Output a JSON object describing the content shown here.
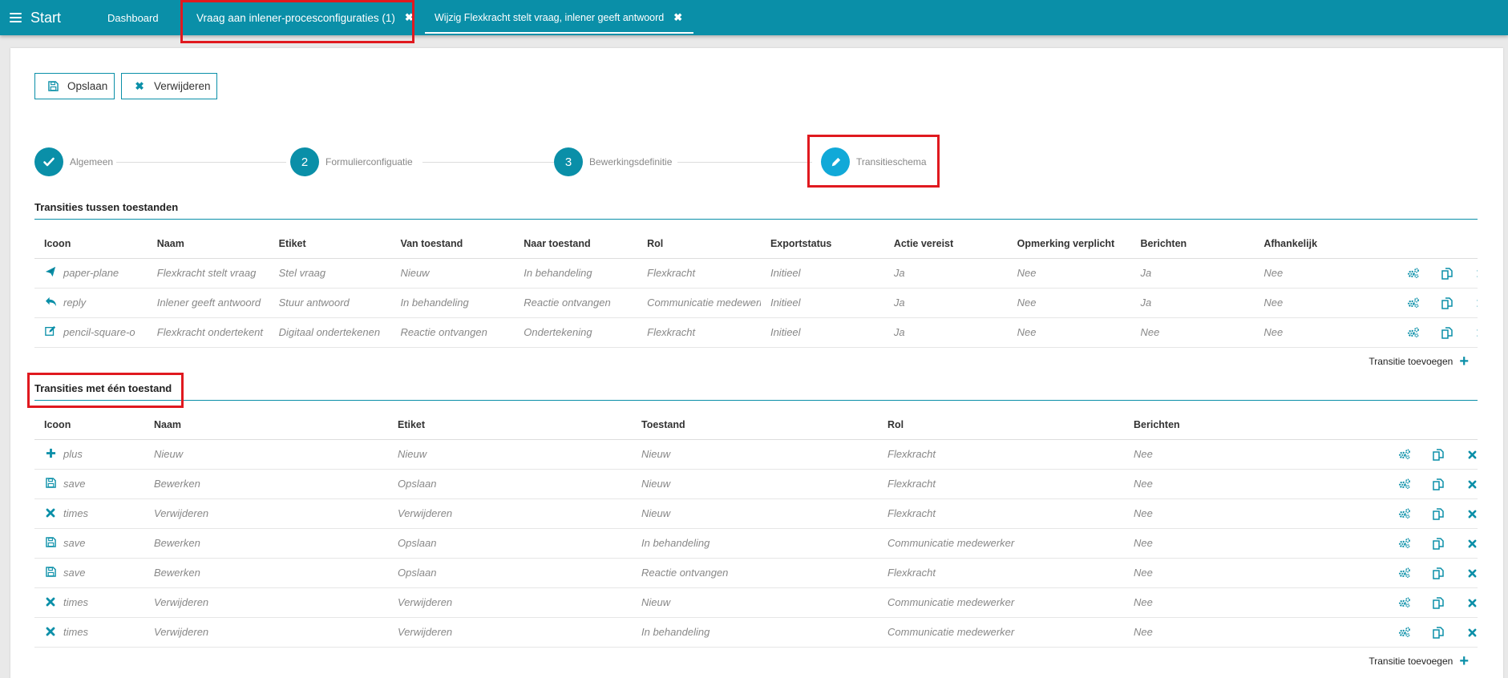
{
  "topbar": {
    "start_label": "Start",
    "tabs": [
      {
        "label": "Dashboard"
      },
      {
        "label": "Vraag aan inlener-procesconfiguraties (1)"
      },
      {
        "label": "Wijzig Flexkracht stelt vraag, inlener geeft antwoord"
      }
    ],
    "close_glyph": "✖"
  },
  "toolbar": {
    "save_label": "Opslaan",
    "delete_label": "Verwijderen"
  },
  "stepper": {
    "steps": [
      {
        "marker": "check-icon",
        "label": "Algemeen"
      },
      {
        "marker": "2",
        "label": "Formulierconfiguatie"
      },
      {
        "marker": "3",
        "label": "Bewerkingsdefinitie"
      },
      {
        "marker": "pencil-icon",
        "label": "Transitieschema"
      }
    ]
  },
  "section1": {
    "title": "Transities tussen toestanden",
    "headers": [
      "Icoon",
      "Naam",
      "Etiket",
      "Van toestand",
      "Naar toestand",
      "Rol",
      "Exportstatus",
      "Actie vereist",
      "Opmerking verplicht",
      "Berichten",
      "Afhankelijk"
    ],
    "rows": [
      {
        "icon": "paper-plane",
        "naam": "Flexkracht stelt vraag",
        "etiket": "Stel vraag",
        "van": "Nieuw",
        "naar": "In behandeling",
        "rol": "Flexkracht",
        "export": "Initieel",
        "actie": "Ja",
        "opmerking": "Nee",
        "berichten": "Ja",
        "afhankelijk": "Nee"
      },
      {
        "icon": "reply",
        "naam": "Inlener geeft antwoord",
        "etiket": "Stuur antwoord",
        "van": "In behandeling",
        "naar": "Reactie ontvangen",
        "rol": "Communicatie medewerker",
        "export": "Initieel",
        "actie": "Ja",
        "opmerking": "Nee",
        "berichten": "Ja",
        "afhankelijk": "Nee"
      },
      {
        "icon": "pencil-square-o",
        "naam": "Flexkracht ondertekent",
        "etiket": "Digitaal ondertekenen",
        "van": "Reactie ontvangen",
        "naar": "Ondertekening",
        "rol": "Flexkracht",
        "export": "Initieel",
        "actie": "Ja",
        "opmerking": "Nee",
        "berichten": "Nee",
        "afhankelijk": "Nee"
      }
    ],
    "add_label": "Transitie toevoegen"
  },
  "section2": {
    "title": "Transities met één toestand",
    "headers": [
      "Icoon",
      "Naam",
      "Etiket",
      "Toestand",
      "Rol",
      "Berichten"
    ],
    "rows": [
      {
        "icon": "plus",
        "naam": "Nieuw",
        "etiket": "Nieuw",
        "toestand": "Nieuw",
        "rol": "Flexkracht",
        "berichten": "Nee"
      },
      {
        "icon": "save",
        "naam": "Bewerken",
        "etiket": "Opslaan",
        "toestand": "Nieuw",
        "rol": "Flexkracht",
        "berichten": "Nee"
      },
      {
        "icon": "times",
        "naam": "Verwijderen",
        "etiket": "Verwijderen",
        "toestand": "Nieuw",
        "rol": "Flexkracht",
        "berichten": "Nee"
      },
      {
        "icon": "save",
        "naam": "Bewerken",
        "etiket": "Opslaan",
        "toestand": "In behandeling",
        "rol": "Communicatie medewerker",
        "berichten": "Nee"
      },
      {
        "icon": "save",
        "naam": "Bewerken",
        "etiket": "Opslaan",
        "toestand": "Reactie ontvangen",
        "rol": "Flexkracht",
        "berichten": "Nee"
      },
      {
        "icon": "times",
        "naam": "Verwijderen",
        "etiket": "Verwijderen",
        "toestand": "Nieuw",
        "rol": "Communicatie medewerker",
        "berichten": "Nee"
      },
      {
        "icon": "times",
        "naam": "Verwijderen",
        "etiket": "Verwijderen",
        "toestand": "In behandeling",
        "rol": "Communicatie medewerker",
        "berichten": "Nee"
      }
    ],
    "add_label": "Transitie toevoegen"
  },
  "colors": {
    "brand": "#0a8fa8",
    "active_step": "#11a9d8",
    "highlight": "#e0191f"
  }
}
